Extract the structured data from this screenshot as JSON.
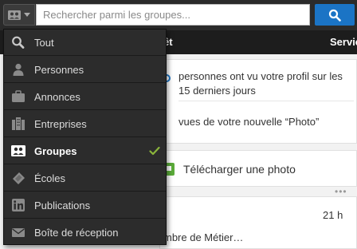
{
  "search": {
    "placeholder": "Rechercher parmi les groupes...",
    "type_icon": "groups-icon"
  },
  "nav": {
    "item_partial_1": "rêt",
    "item_partial_2": "Servic"
  },
  "menu": {
    "items": [
      {
        "label": "Tout",
        "icon": "search-icon",
        "selected": false
      },
      {
        "label": "Personnes",
        "icon": "person-icon",
        "selected": false
      },
      {
        "label": "Annonces",
        "icon": "briefcase-icon",
        "selected": false
      },
      {
        "label": "Entreprises",
        "icon": "building-icon",
        "selected": false
      },
      {
        "label": "Groupes",
        "icon": "groups-icon",
        "selected": true
      },
      {
        "label": "Écoles",
        "icon": "school-icon",
        "selected": false
      },
      {
        "label": "Publications",
        "icon": "linkedin-icon",
        "selected": false
      },
      {
        "label": "Boîte de réception",
        "icon": "envelope-icon",
        "selected": false
      }
    ]
  },
  "feed": {
    "profile_views_text": "personnes ont vu votre profil sur les 15 derniers jours",
    "photo_views_text": "vues de votre nouvelle “Photo”",
    "upload_photo_label": "Télécharger une photo",
    "more_dots": "•••",
    "post_time": "21 h",
    "post_text_partial": "mbre de Métier…"
  },
  "colors": {
    "accent": "#1b74c5",
    "check": "#8ab43b",
    "menu_bg": "#2c2c2c",
    "upload_icon": "#5bab3a"
  }
}
